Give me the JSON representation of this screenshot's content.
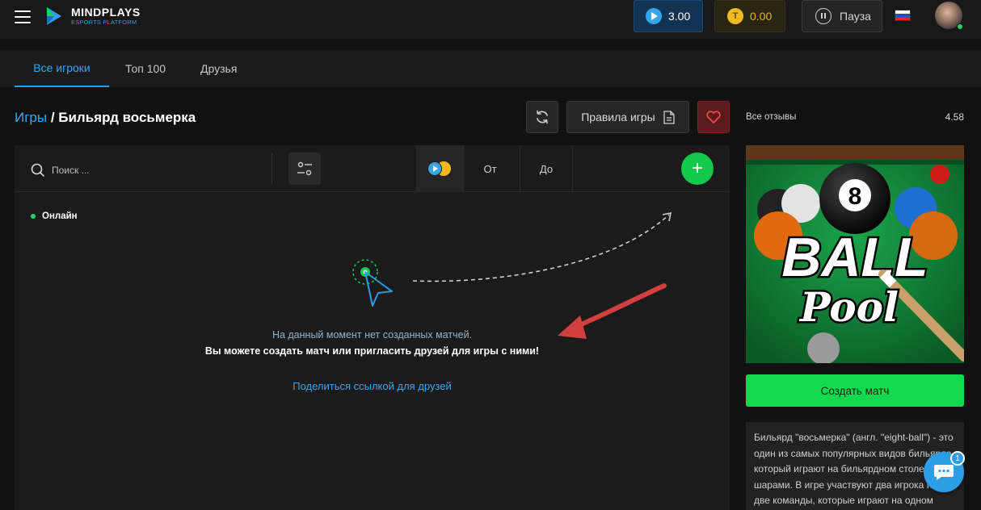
{
  "header": {
    "brand": "MINDPLAYS",
    "brand_sub": "ESPORTS PLATFORM",
    "balance_blue": "3.00",
    "balance_gold": "0.00",
    "pause_label": "Пауза",
    "gold_coin_glyph": "T",
    "language_flag": "ru-flag"
  },
  "tabs": [
    {
      "label": "Все игроки",
      "active": true
    },
    {
      "label": "Топ 100",
      "active": false
    },
    {
      "label": "Друзья",
      "active": false
    }
  ],
  "breadcrumb": {
    "link": "Игры",
    "separator": " / ",
    "current": "Бильярд восьмерка"
  },
  "toolbar": {
    "rules_label": "Правила игры"
  },
  "filters": {
    "search_placeholder": "Поиск ...",
    "from_label": "От",
    "to_label": "До"
  },
  "online_label": "Онлайн",
  "empty_state": {
    "line1": "На данный момент нет созданных матчей.",
    "line2": "Вы можете создать матч или пригласить друзей для игры с ними!",
    "share_link": "Поделиться ссылкой для друзей"
  },
  "sidebar": {
    "reviews_label": "Все отзывы",
    "rating": "4.58",
    "game_image": {
      "ball_number": "8",
      "word1": "BALL",
      "word2": "Pool"
    },
    "create_match_label": "Создать матч",
    "description": "Бильярд \"восьмерка\" (англ. \"eight-ball\") - это один из самых популярных видов бильярда, который играют на бильярдном столе с шарами. В игре участвуют два игрока или две команды, которые играют на одном столе. Цель игры - забить все"
  },
  "chat": {
    "badge": "1"
  },
  "colors": {
    "accent_blue": "#2d9de8",
    "accent_green": "#12d94f",
    "gold": "#f0b91d",
    "favorite_red": "#5a1c1c"
  }
}
